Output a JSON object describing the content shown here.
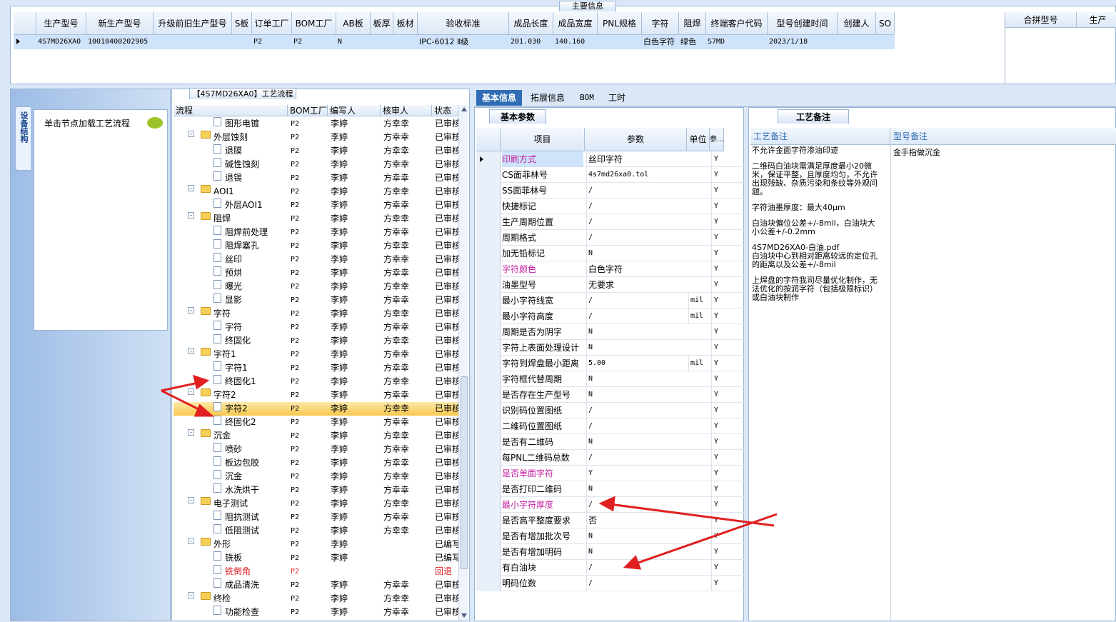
{
  "main_info": {
    "title": "主要信息",
    "columns": [
      "生产型号",
      "新生产型号",
      "升级前旧生产型号",
      "S板",
      "订单工厂",
      "BOM工厂",
      "AB板",
      "板厚",
      "板材",
      "验收标准",
      "成品长度",
      "成品宽度",
      "PNL规格",
      "字符",
      "阻焊",
      "终端客户代码",
      "型号创建时间",
      "创建人",
      "SO"
    ],
    "row": [
      "4S7MD26XA0",
      "10010400202905",
      "",
      "",
      "P2",
      "P2",
      "N",
      "",
      "",
      "IPC-6012 Ⅱ级",
      "201.030",
      "140.160",
      "",
      "白色字符",
      "绿色",
      "S7MD",
      "2023/1/18",
      "",
      ""
    ],
    "right_columns": [
      "合拼型号",
      "生产"
    ]
  },
  "left_panel": {
    "vertical_tab": "设备结构",
    "hint": "单击节点加载工艺流程"
  },
  "flow_panel": {
    "title": "【4S7MD26XA0】工艺流程",
    "columns": [
      "流程",
      "BOM工厂",
      "编写人",
      "核审人",
      "状态"
    ],
    "rows": [
      {
        "level": 2,
        "type": "doc",
        "name": "图形电镀",
        "bom": "P2",
        "author": "李婷",
        "reviewer": "方幸幸",
        "status": "已审核"
      },
      {
        "level": 1,
        "type": "folder",
        "name": "外层蚀刻",
        "bom": "P2",
        "author": "李婷",
        "reviewer": "方幸幸",
        "status": "已审核"
      },
      {
        "level": 2,
        "type": "doc",
        "name": "退膜",
        "bom": "P2",
        "author": "李婷",
        "reviewer": "方幸幸",
        "status": "已审核"
      },
      {
        "level": 2,
        "type": "doc",
        "name": "碱性蚀刻",
        "bom": "P2",
        "author": "李婷",
        "reviewer": "方幸幸",
        "status": "已审核"
      },
      {
        "level": 2,
        "type": "doc",
        "name": "退锡",
        "bom": "P2",
        "author": "李婷",
        "reviewer": "方幸幸",
        "status": "已审核"
      },
      {
        "level": 1,
        "type": "folder",
        "name": "AOI1",
        "bom": "P2",
        "author": "李婷",
        "reviewer": "方幸幸",
        "status": "已审核"
      },
      {
        "level": 2,
        "type": "doc",
        "name": "外层AOI1",
        "bom": "P2",
        "author": "李婷",
        "reviewer": "方幸幸",
        "status": "已审核"
      },
      {
        "level": 1,
        "type": "folder",
        "name": "阻焊",
        "bom": "P2",
        "author": "李婷",
        "reviewer": "方幸幸",
        "status": "已审核"
      },
      {
        "level": 2,
        "type": "doc",
        "name": "阻焊前处理",
        "bom": "P2",
        "author": "李婷",
        "reviewer": "方幸幸",
        "status": "已审核"
      },
      {
        "level": 2,
        "type": "doc",
        "name": "阻焊塞孔",
        "bom": "P2",
        "author": "李婷",
        "reviewer": "方幸幸",
        "status": "已审核"
      },
      {
        "level": 2,
        "type": "doc",
        "name": "丝印",
        "bom": "P2",
        "author": "李婷",
        "reviewer": "方幸幸",
        "status": "已审核"
      },
      {
        "level": 2,
        "type": "doc",
        "name": "预烘",
        "bom": "P2",
        "author": "李婷",
        "reviewer": "方幸幸",
        "status": "已审核"
      },
      {
        "level": 2,
        "type": "doc",
        "name": "曝光",
        "bom": "P2",
        "author": "李婷",
        "reviewer": "方幸幸",
        "status": "已审核"
      },
      {
        "level": 2,
        "type": "doc",
        "name": "显影",
        "bom": "P2",
        "author": "李婷",
        "reviewer": "方幸幸",
        "status": "已审核"
      },
      {
        "level": 1,
        "type": "folder",
        "name": "字符",
        "bom": "P2",
        "author": "李婷",
        "reviewer": "方幸幸",
        "status": "已审核"
      },
      {
        "level": 2,
        "type": "doc",
        "name": "字符",
        "bom": "P2",
        "author": "李婷",
        "reviewer": "方幸幸",
        "status": "已审核"
      },
      {
        "level": 2,
        "type": "doc",
        "name": "终固化",
        "bom": "P2",
        "author": "李婷",
        "reviewer": "方幸幸",
        "status": "已审核"
      },
      {
        "level": 1,
        "type": "folder",
        "name": "字符1",
        "bom": "P2",
        "author": "李婷",
        "reviewer": "方幸幸",
        "status": "已审核"
      },
      {
        "level": 2,
        "type": "doc",
        "name": "字符1",
        "bom": "P2",
        "author": "李婷",
        "reviewer": "方幸幸",
        "status": "已审核"
      },
      {
        "level": 2,
        "type": "doc",
        "name": "终固化1",
        "bom": "P2",
        "author": "李婷",
        "reviewer": "方幸幸",
        "status": "已审核"
      },
      {
        "level": 1,
        "type": "folder",
        "name": "字符2",
        "bom": "P2",
        "author": "李婷",
        "reviewer": "方幸幸",
        "status": "已审核"
      },
      {
        "level": 2,
        "type": "doc",
        "name": "字符2",
        "bom": "P2",
        "author": "李婷",
        "reviewer": "方幸幸",
        "status": "已审核",
        "selected": true
      },
      {
        "level": 2,
        "type": "doc",
        "name": "终固化2",
        "bom": "P2",
        "author": "李婷",
        "reviewer": "方幸幸",
        "status": "已审核"
      },
      {
        "level": 1,
        "type": "folder",
        "name": "沉金",
        "bom": "P2",
        "author": "李婷",
        "reviewer": "方幸幸",
        "status": "已审核"
      },
      {
        "level": 2,
        "type": "doc",
        "name": "喷砂",
        "bom": "P2",
        "author": "李婷",
        "reviewer": "方幸幸",
        "status": "已审核"
      },
      {
        "level": 2,
        "type": "doc",
        "name": "板边包胶",
        "bom": "P2",
        "author": "李婷",
        "reviewer": "方幸幸",
        "status": "已审核"
      },
      {
        "level": 2,
        "type": "doc",
        "name": "沉金",
        "bom": "P2",
        "author": "李婷",
        "reviewer": "方幸幸",
        "status": "已审核"
      },
      {
        "level": 2,
        "type": "doc",
        "name": "水洗烘干",
        "bom": "P2",
        "author": "李婷",
        "reviewer": "方幸幸",
        "status": "已审核"
      },
      {
        "level": 1,
        "type": "folder",
        "name": "电子测试",
        "bom": "P2",
        "author": "李婷",
        "reviewer": "方幸幸",
        "status": "已审核"
      },
      {
        "level": 2,
        "type": "doc",
        "name": "阻抗测试",
        "bom": "P2",
        "author": "李婷",
        "reviewer": "方幸幸",
        "status": "已审核"
      },
      {
        "level": 2,
        "type": "doc",
        "name": "低阻测试",
        "bom": "P2",
        "author": "李婷",
        "reviewer": "方幸幸",
        "status": "已审核"
      },
      {
        "level": 1,
        "type": "folder",
        "name": "外形",
        "bom": "P2",
        "author": "李婷",
        "reviewer": "",
        "status": "已编写"
      },
      {
        "level": 2,
        "type": "doc",
        "name": "铣板",
        "bom": "P2",
        "author": "李婷",
        "reviewer": "",
        "status": "已编写"
      },
      {
        "level": 2,
        "type": "doc",
        "name": "铣倒角",
        "bom": "P2",
        "author": "",
        "reviewer": "",
        "status": "回退",
        "red": true
      },
      {
        "level": 2,
        "type": "doc",
        "name": "成品清洗",
        "bom": "P2",
        "author": "李婷",
        "reviewer": "方幸幸",
        "status": "已审核"
      },
      {
        "level": 1,
        "type": "folder",
        "name": "终检",
        "bom": "P2",
        "author": "李婷",
        "reviewer": "方幸幸",
        "status": "已审核"
      },
      {
        "level": 2,
        "type": "doc",
        "name": "功能检查",
        "bom": "P2",
        "author": "李婷",
        "reviewer": "方幸幸",
        "status": "已审核"
      }
    ]
  },
  "tabs": [
    "基本信息",
    "拓展信息",
    "BOM",
    "工时"
  ],
  "params_panel": {
    "title": "基本参数",
    "columns": [
      "项目",
      "参数",
      "单位",
      "参..."
    ],
    "rows": [
      {
        "item": "印刷方式",
        "value": "丝印字符",
        "unit": "",
        "flag": "Y",
        "pink": true,
        "current": true
      },
      {
        "item": "CS面菲林号",
        "value": "4s7md26xa0.tol",
        "unit": "",
        "flag": "Y"
      },
      {
        "item": "SS面菲林号",
        "value": "/",
        "unit": "",
        "flag": "Y"
      },
      {
        "item": "快捷标记",
        "value": "/",
        "unit": "",
        "flag": "Y"
      },
      {
        "item": "生产周期位置",
        "value": "/",
        "unit": "",
        "flag": "Y"
      },
      {
        "item": "周期格式",
        "value": "/",
        "unit": "",
        "flag": "Y"
      },
      {
        "item": "加无铅标记",
        "value": "N",
        "unit": "",
        "flag": "Y"
      },
      {
        "item": "字符颜色",
        "value": "白色字符",
        "unit": "",
        "flag": "Y",
        "pink": true
      },
      {
        "item": "油墨型号",
        "value": "无要求",
        "unit": "",
        "flag": "Y"
      },
      {
        "item": "最小字符线宽",
        "value": "/",
        "unit": "mil",
        "flag": "Y"
      },
      {
        "item": "最小字符高度",
        "value": "/",
        "unit": "mil",
        "flag": "Y"
      },
      {
        "item": "周期是否为阴字",
        "value": "N",
        "unit": "",
        "flag": "Y"
      },
      {
        "item": "字符上表面处理设计",
        "value": "N",
        "unit": "",
        "flag": "Y"
      },
      {
        "item": "字符到焊盘最小距离",
        "value": "5.00",
        "unit": "mil",
        "flag": "Y"
      },
      {
        "item": "字符框代替周期",
        "value": "N",
        "unit": "",
        "flag": "Y"
      },
      {
        "item": "是否存在生产型号",
        "value": "N",
        "unit": "",
        "flag": "Y"
      },
      {
        "item": "识别码位置图纸",
        "value": "/",
        "unit": "",
        "flag": "Y"
      },
      {
        "item": "二维码位置图纸",
        "value": "/",
        "unit": "",
        "flag": "Y"
      },
      {
        "item": "是否有二维码",
        "value": "N",
        "unit": "",
        "flag": "Y"
      },
      {
        "item": "每PNL二维码总数",
        "value": "/",
        "unit": "",
        "flag": "Y"
      },
      {
        "item": "是否单面字符",
        "value": "Y",
        "unit": "",
        "flag": "Y",
        "pink": true
      },
      {
        "item": "是否打印二维码",
        "value": "N",
        "unit": "",
        "flag": "Y"
      },
      {
        "item": "最小字符厚度",
        "value": "/",
        "unit": "",
        "flag": "Y",
        "pink": true
      },
      {
        "item": "是否高平整度要求",
        "value": "否",
        "unit": "",
        "flag": "Y"
      },
      {
        "item": "是否有增加批次号",
        "value": "N",
        "unit": "",
        "flag": "Y"
      },
      {
        "item": "是否有增加明码",
        "value": "N",
        "unit": "",
        "flag": "Y"
      },
      {
        "item": "有白油块",
        "value": "/",
        "unit": "",
        "flag": "Y"
      },
      {
        "item": "明码位数",
        "value": "/",
        "unit": "",
        "flag": "Y"
      }
    ]
  },
  "notes_panel": {
    "title": "工艺备注",
    "col1": "工艺备注",
    "col2": "型号备注",
    "process_notes": [
      "不允许金面字符渗油印迹",
      "",
      "二维码白油块需满足厚度最小20微米，保证平整，且厚度均匀，不允许出现残缺、杂质污染和条纹等外观问题。",
      "",
      "字符油墨厚度：最大40μm",
      "",
      "白油块偏位公差+/-8mil，白油块大小公差+/-0.2mm",
      "",
      "4S7MD26XA0-白油.pdf",
      "白油块中心到相对距离较远的定位孔的距离以及公差+/-8mil",
      "",
      "上焊盘的字符我司尽量优化制作，无法优化的按润字符（包括极限标识）或白油块制作"
    ],
    "model_note": "金手指做沉金"
  },
  "colors": {
    "accent": "#2f6db5",
    "pink": "#c020a0",
    "red": "#e02020",
    "selected": "#fbd97a",
    "row_select": "#cfe3fb"
  }
}
